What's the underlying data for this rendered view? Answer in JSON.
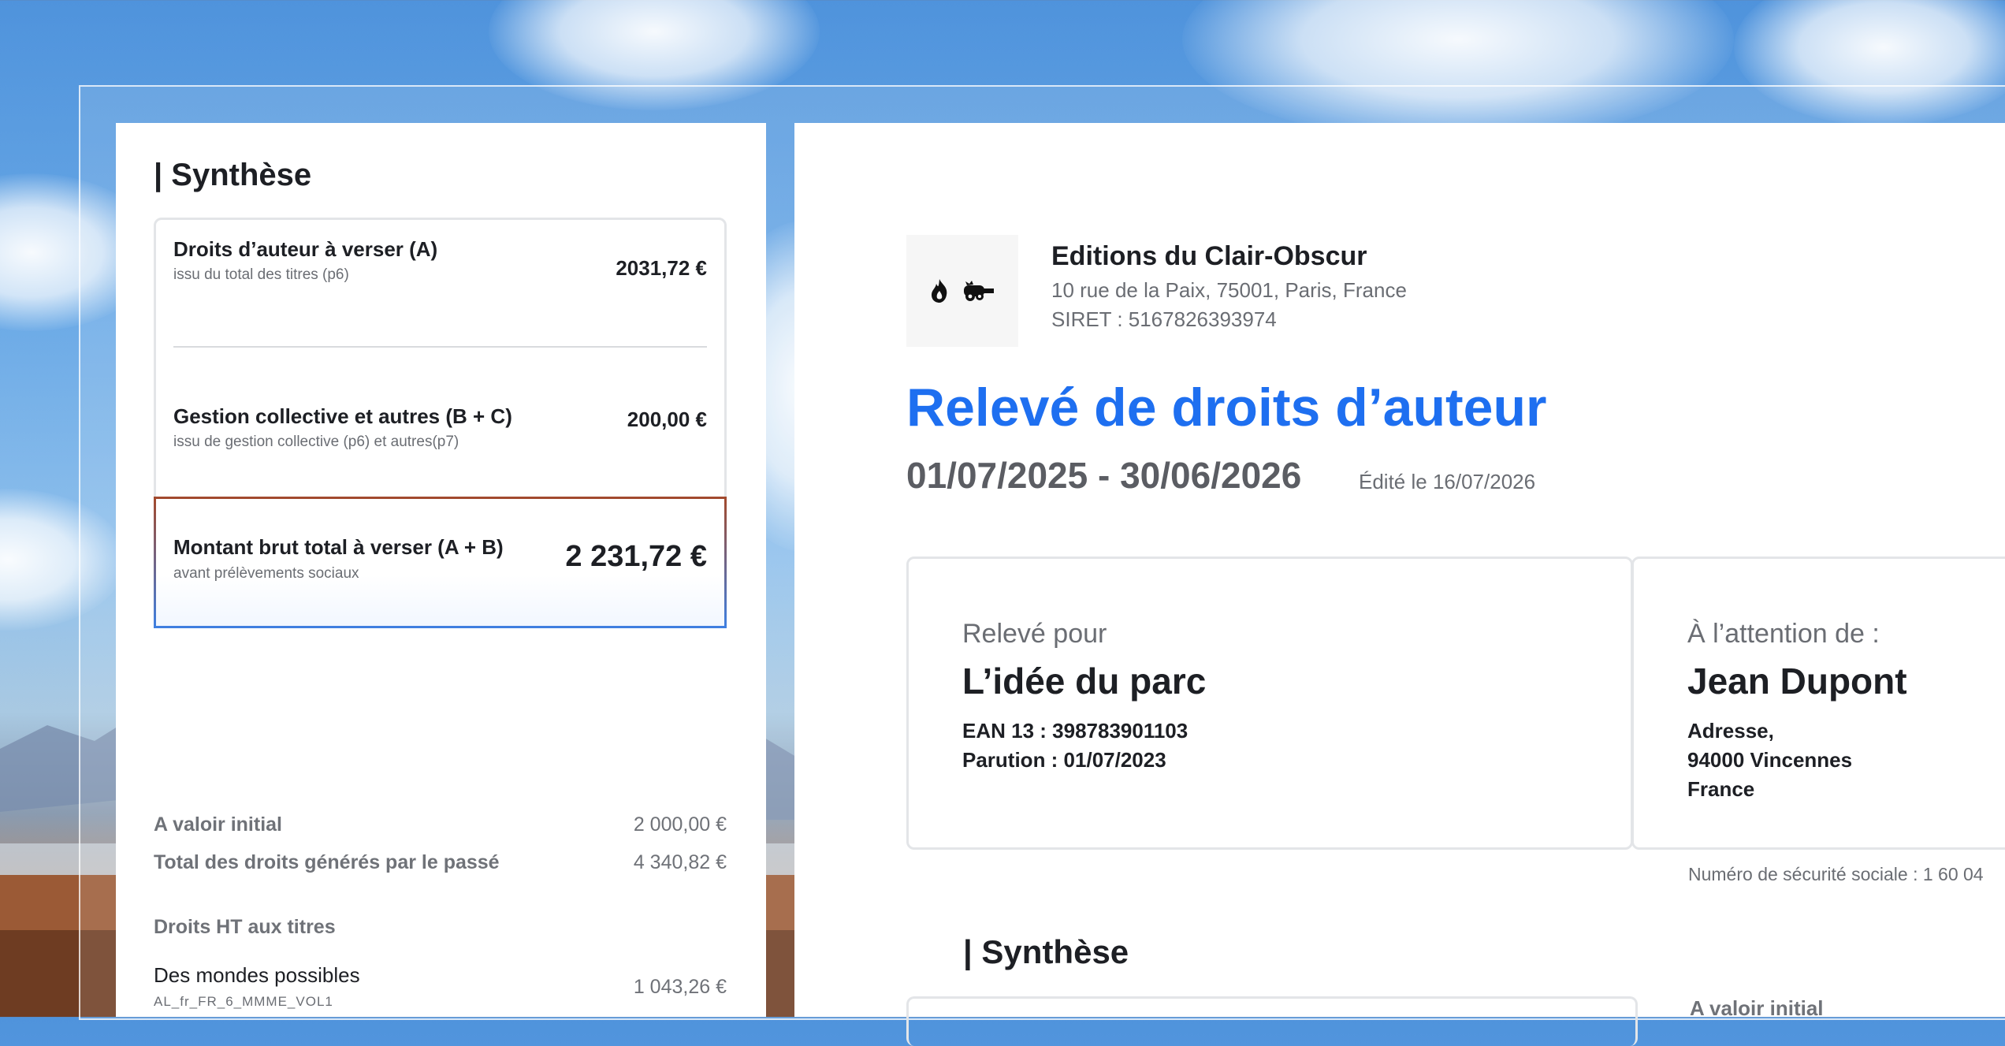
{
  "left": {
    "title": "| Synthèse",
    "rows": [
      {
        "label": "Droits d’auteur à verser (A)",
        "sub": "issu du total des titres (p6)",
        "amount": "2031,72 €"
      },
      {
        "label": "Gestion collective et autres (B + C)",
        "sub": "issu de gestion collective (p6) et autres(p7)",
        "amount": "200,00 €"
      }
    ],
    "total": {
      "label": "Montant brut total à verser (A + B)",
      "sub": "avant prélèvements sociaux",
      "amount": "2 231,72 €"
    },
    "info": [
      {
        "label": "A valoir initial",
        "value": "2 000,00 €"
      },
      {
        "label": "Total des droits générés par le passé",
        "value": "4 340,82 €"
      }
    ],
    "titles_heading": "Droits HT aux titres",
    "titles": [
      {
        "name": "Des mondes possibles",
        "code": "AL_fr_FR_6_MMME_VOL1",
        "value": "1 043,26 €"
      }
    ]
  },
  "right": {
    "logo_icons": [
      "flame-icon",
      "cannon-icon"
    ],
    "company": {
      "name": "Editions du Clair-Obscur",
      "address": "10 rue de la Paix, 75001, Paris, France",
      "siret": "SIRET : 5167826393974"
    },
    "doc_title": "Relevé de droits d’auteur",
    "period": "01/07/2025 - 30/06/2026",
    "edited": "Édité le 16/07/2026",
    "card_left": {
      "caption": "Relevé pour",
      "name": "L’idée du parc",
      "ean": "EAN 13 : 398783901103",
      "parution": "Parution : 01/07/2023"
    },
    "card_right": {
      "caption": "À l’attention de :",
      "name": "Jean Dupont",
      "addr1": "Adresse,",
      "addr2": "94000 Vincennes",
      "addr3": "France"
    },
    "ssn": "Numéro de sécurité sociale : 1 60 04",
    "synth_title": "| Synthèse",
    "avaloir": "A valoir initial"
  },
  "colors": {
    "accent": "#1e6ff0",
    "text": "#1d1f24",
    "muted": "#6a6d73",
    "border": "#e3e5e8"
  }
}
